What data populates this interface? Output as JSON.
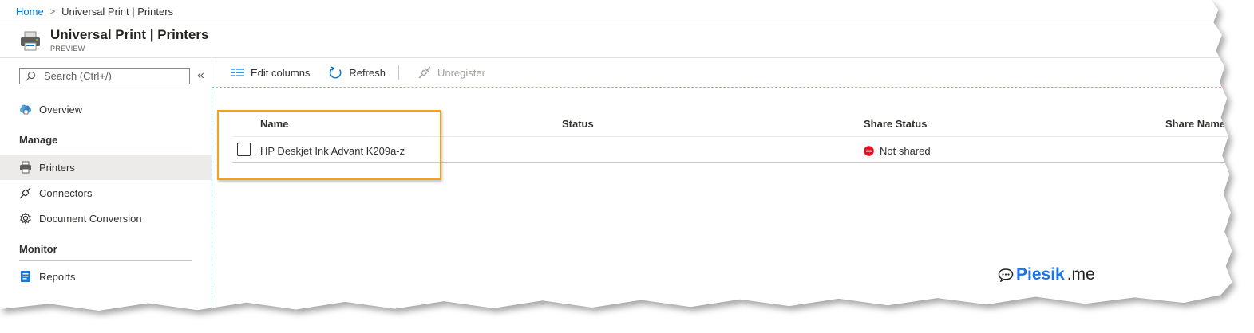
{
  "breadcrumb": {
    "home": "Home",
    "separator": ">",
    "current": "Universal Print | Printers"
  },
  "header": {
    "title": "Universal Print | Printers",
    "subtitle": "PREVIEW",
    "icon": "printer-icon"
  },
  "sidebar": {
    "search_placeholder": "Search (Ctrl+/)",
    "collapse": "«",
    "overview": "Overview",
    "sections": {
      "manage": "Manage",
      "monitor": "Monitor"
    },
    "items": {
      "printers": "Printers",
      "connectors": "Connectors",
      "document_conversion": "Document Conversion",
      "reports": "Reports"
    },
    "active": "Printers"
  },
  "toolbar": {
    "edit_columns": "Edit columns",
    "refresh": "Refresh",
    "unregister": "Unregister"
  },
  "table": {
    "columns": [
      "Name",
      "Status",
      "Share Status",
      "Share Name"
    ],
    "rows": [
      {
        "name": "HP Deskjet Ink Advant K209a-z",
        "status": "",
        "share_status": "Not shared",
        "share_name": ""
      }
    ]
  },
  "colors": {
    "accent": "#0078d4",
    "highlight": "#f3a21a",
    "status_not_shared": "#e81123"
  },
  "watermark": {
    "part1": "Piesik",
    "part2": ".me"
  }
}
